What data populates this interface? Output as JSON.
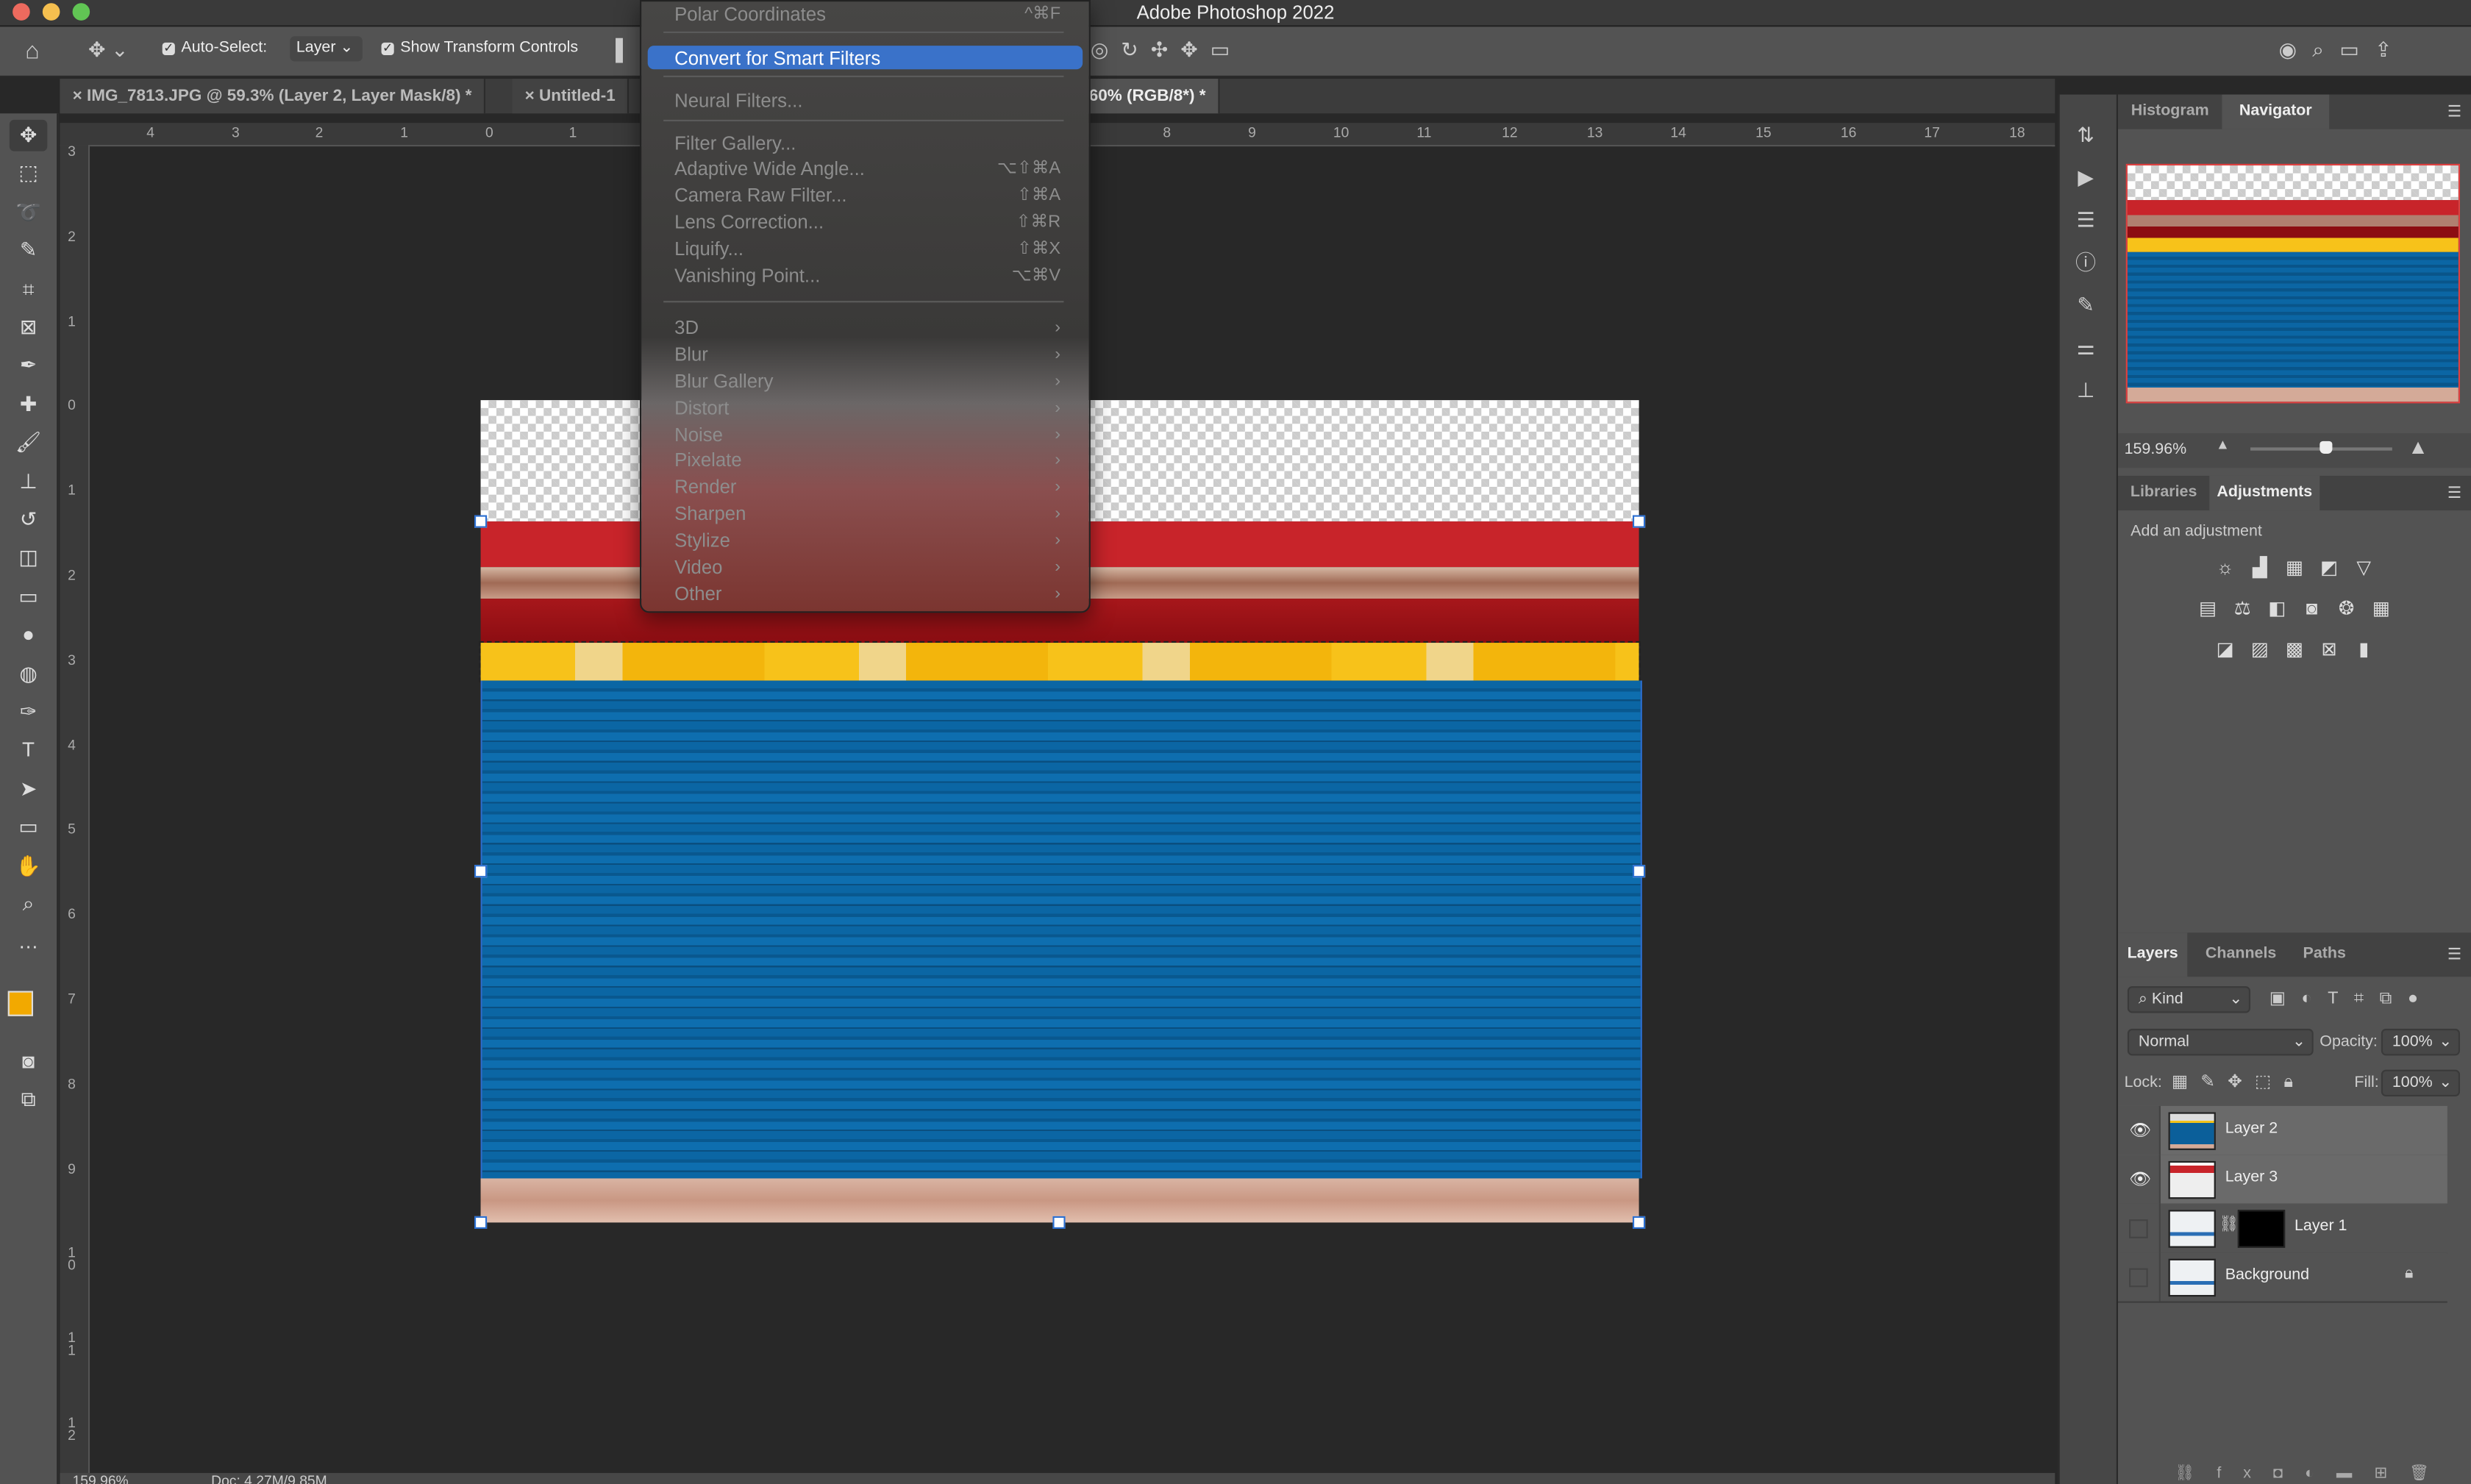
{
  "app_title": "Adobe Photoshop 2022",
  "options": {
    "auto_select_label": "Auto-Select:",
    "auto_select_value": "Layer",
    "show_transform_label": "Show Transform Controls"
  },
  "doc_tabs": [
    "IMG_7813.JPG @ 59.3% (Layer 2, Layer Mask/8) *",
    "Untitled-1",
    "60% (RGB/8*) *"
  ],
  "ruler_top": [
    "4",
    "3",
    "2",
    "1",
    "0",
    "1",
    "8",
    "9",
    "10",
    "11",
    "12",
    "13",
    "14",
    "15",
    "16",
    "17",
    "18"
  ],
  "ruler_left": [
    "3",
    "2",
    "1",
    "0",
    "1",
    "2",
    "3",
    "4",
    "5",
    "6",
    "7",
    "8",
    "9",
    "1 0",
    "1 1",
    "1 2"
  ],
  "filter_menu": {
    "items": [
      {
        "label": "Polar Coordinates",
        "shortcut": "^⌘F"
      },
      {
        "label": "Convert for Smart Filters",
        "highlighted": true
      },
      {
        "label": "Neural Filters..."
      },
      {
        "label": "Filter Gallery..."
      },
      {
        "label": "Adaptive Wide Angle...",
        "shortcut": "⌥⇧⌘A"
      },
      {
        "label": "Camera Raw Filter...",
        "shortcut": "⇧⌘A"
      },
      {
        "label": "Lens Correction...",
        "shortcut": "⇧⌘R"
      },
      {
        "label": "Liquify...",
        "shortcut": "⇧⌘X"
      },
      {
        "label": "Vanishing Point...",
        "shortcut": "⌥⌘V"
      },
      {
        "label": "3D",
        "submenu": true
      },
      {
        "label": "Blur",
        "submenu": true
      },
      {
        "label": "Blur Gallery",
        "submenu": true
      },
      {
        "label": "Distort",
        "submenu": true
      },
      {
        "label": "Noise",
        "submenu": true
      },
      {
        "label": "Pixelate",
        "submenu": true
      },
      {
        "label": "Render",
        "submenu": true
      },
      {
        "label": "Sharpen",
        "submenu": true
      },
      {
        "label": "Stylize",
        "submenu": true
      },
      {
        "label": "Video",
        "submenu": true
      },
      {
        "label": "Other",
        "submenu": true
      }
    ]
  },
  "navigator": {
    "tabs": [
      "Histogram",
      "Navigator"
    ],
    "zoom": "159.96%",
    "slider_fraction": 0.53
  },
  "adjustments": {
    "tabs": [
      "Libraries",
      "Adjustments"
    ],
    "heading": "Add an adjustment"
  },
  "layers_panel": {
    "tabs": [
      "Layers",
      "Channels",
      "Paths"
    ],
    "filter_kind": "Kind",
    "blend_mode": "Normal",
    "opacity_label": "Opacity:",
    "opacity": "100%",
    "lock_label": "Lock:",
    "fill_label": "Fill:",
    "fill": "100%",
    "layers": [
      {
        "name": "Layer 2",
        "visible": true,
        "selected": true
      },
      {
        "name": "Layer 3",
        "visible": true,
        "selected": true
      },
      {
        "name": "Layer 1",
        "visible": false,
        "selected": false
      },
      {
        "name": "Background",
        "visible": false,
        "selected": false,
        "locked": true
      }
    ]
  },
  "status": {
    "zoom": "159.96%",
    "doc": "Doc: 4.27M/9.85M"
  },
  "colors": {
    "foreground": "#f2a900",
    "background": "#ffffff",
    "highlight": "#3a72c9"
  }
}
